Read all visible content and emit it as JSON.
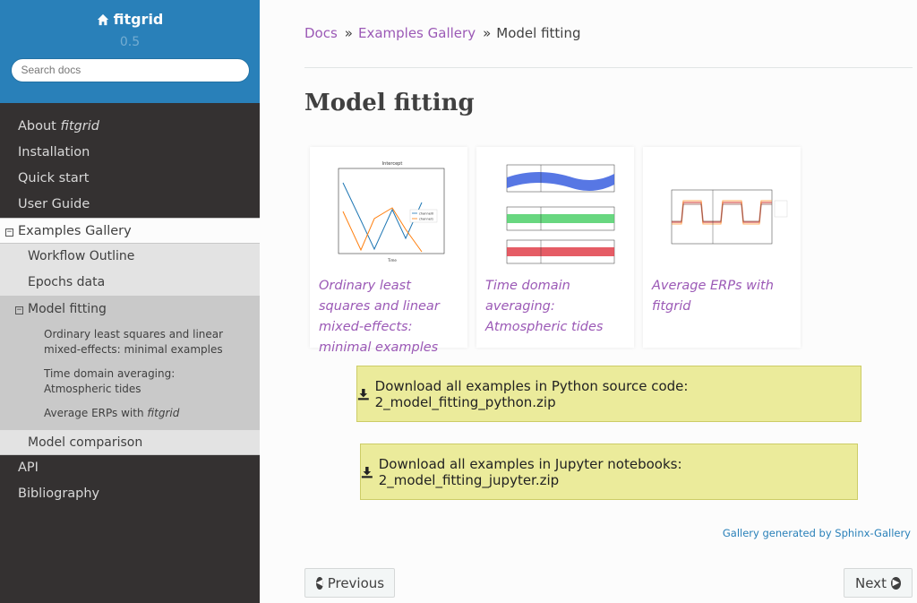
{
  "sidebar": {
    "brand": "fitgrid",
    "version": "0.5",
    "search_placeholder": "Search docs",
    "items": [
      {
        "label_pre": "About ",
        "label_em": "fitgrid"
      },
      {
        "label": "Installation"
      },
      {
        "label": "Quick start"
      },
      {
        "label": "User Guide"
      }
    ],
    "current": {
      "label": "Examples Gallery",
      "toggle": "⊟"
    },
    "sub": [
      {
        "label": "Workflow Outline"
      },
      {
        "label": "Epochs data"
      }
    ],
    "sub_current": {
      "label": "Model fitting",
      "toggle": "⊟"
    },
    "sub_sub": [
      {
        "label": "Ordinary least squares and linear mixed-effects: minimal examples"
      },
      {
        "label": "Time domain averaging: Atmospheric tides"
      },
      {
        "label_pre": "Average ERPs with ",
        "label_em": "fitgrid"
      }
    ],
    "sub_after": {
      "label": "Model comparison"
    },
    "after": [
      {
        "label": "API"
      },
      {
        "label": "Bibliography"
      }
    ]
  },
  "breadcrumb": {
    "docs": "Docs",
    "sep": "»",
    "gallery": "Examples Gallery",
    "current": "Model fitting"
  },
  "page_title": "Model fitting",
  "cards": [
    {
      "caption": "Ordinary least squares and linear mixed-effects: minimal examples",
      "thumb_title": "Intercept",
      "legend": [
        "channel0",
        "channel1"
      ],
      "xlabel": "Time"
    },
    {
      "caption": "Time domain averaging: Atmospheric tides"
    },
    {
      "caption": "Average ERPs with fitgrid"
    }
  ],
  "downloads": {
    "python": "Download all examples in Python source code: 2_model_fitting_python.zip",
    "jupyter": "Download all examples in Jupyter notebooks: 2_model_fitting_jupyter.zip"
  },
  "generated_by": "Gallery generated by Sphinx-Gallery",
  "nav": {
    "previous": "Previous",
    "next": "Next"
  },
  "colors": {
    "sidebar_top": "#2980b9",
    "sidebar_bg": "#343131",
    "link": "#9b59b6",
    "download_bg": "#ebeb9b"
  },
  "icons": {
    "home": "home-icon",
    "download": "download-icon",
    "prev": "arrow-circle-left-icon",
    "next": "arrow-circle-right-icon"
  }
}
